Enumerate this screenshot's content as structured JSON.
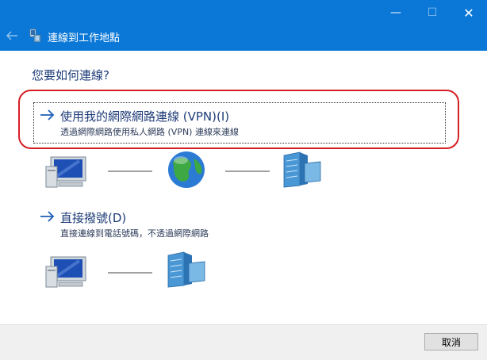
{
  "window": {
    "title": "連線到工作地點",
    "controls": {
      "minimize": "—",
      "maximize": "☐",
      "close": "✕"
    }
  },
  "content": {
    "heading": "您要如何連線?",
    "options": [
      {
        "label": "使用我的網際網路連線 (VPN)(I)",
        "description": "透過網際網路使用私人網路 (VPN) 連線來連線",
        "icon": "right-arrow-icon"
      },
      {
        "label": "直接撥號(D)",
        "description": "直接連線到電話號碼，不透過網際網路",
        "icon": "right-arrow-icon"
      }
    ]
  },
  "footer": {
    "cancel_label": "取消"
  },
  "colors": {
    "titlebar": "#0b78d7",
    "link_text": "#1e3c78",
    "highlight": "#d51f26",
    "footer": "#f0f0f0"
  }
}
